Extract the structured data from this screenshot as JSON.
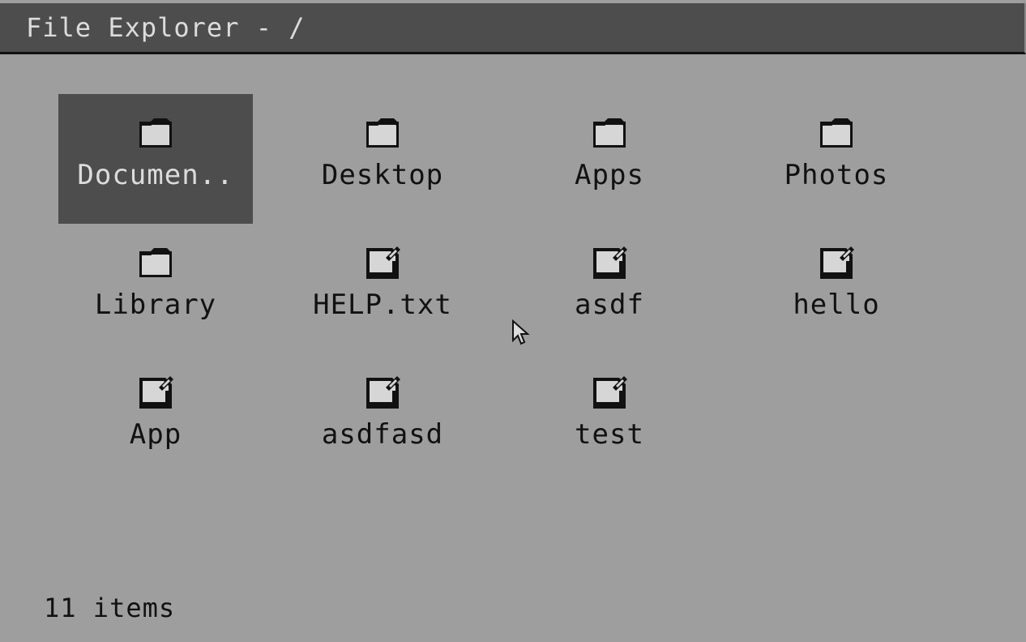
{
  "window": {
    "title": "File Explorer - /"
  },
  "items": [
    {
      "name": "Documen..",
      "type": "folder",
      "icon": "folder-icon",
      "selected": true
    },
    {
      "name": "Desktop",
      "type": "folder",
      "icon": "folder-icon",
      "selected": false
    },
    {
      "name": "Apps",
      "type": "folder",
      "icon": "folder-icon",
      "selected": false
    },
    {
      "name": "Photos",
      "type": "folder",
      "icon": "folder-icon",
      "selected": false
    },
    {
      "name": "Library",
      "type": "folder",
      "icon": "folder-icon",
      "selected": false
    },
    {
      "name": "HELP.txt",
      "type": "file",
      "icon": "file-icon",
      "selected": false
    },
    {
      "name": "asdf",
      "type": "file",
      "icon": "file-icon",
      "selected": false
    },
    {
      "name": "hello",
      "type": "file",
      "icon": "file-icon",
      "selected": false
    },
    {
      "name": "App",
      "type": "file",
      "icon": "file-icon",
      "selected": false
    },
    {
      "name": "asdfasd",
      "type": "file",
      "icon": "file-icon",
      "selected": false
    },
    {
      "name": "test",
      "type": "file",
      "icon": "file-icon",
      "selected": false
    }
  ],
  "status": {
    "count_label": "11 items"
  },
  "colors": {
    "background": "#9e9e9e",
    "titlebar": "#4d4d4d",
    "selection": "#4d4d4d",
    "text": "#111111",
    "text_inverse": "#dcdcdc",
    "icon_fill": "#d6d6d6"
  }
}
